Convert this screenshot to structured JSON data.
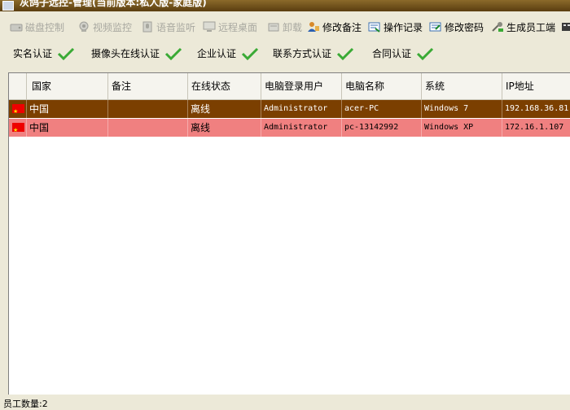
{
  "window": {
    "title": "灰鸽子远控-管理(当前版本:私人版-家庭版)"
  },
  "toolbar": {
    "items": [
      {
        "label": "磁盘控制",
        "icon": "disk-icon",
        "enabled": false
      },
      {
        "label": "视频监控",
        "icon": "webcam-icon",
        "enabled": false
      },
      {
        "label": "语音监听",
        "icon": "microphone-icon",
        "enabled": false
      },
      {
        "label": "远程桌面",
        "icon": "monitor-icon",
        "enabled": false
      },
      {
        "label": "卸载",
        "icon": "uninstall-icon",
        "enabled": false
      },
      {
        "label": "修改备注",
        "icon": "user-edit-icon",
        "enabled": true
      },
      {
        "label": "操作记录",
        "icon": "log-icon",
        "enabled": true
      },
      {
        "label": "修改密码",
        "icon": "password-icon",
        "enabled": true
      },
      {
        "label": "生成员工端",
        "icon": "build-icon",
        "enabled": true
      }
    ]
  },
  "certifications": [
    {
      "label": "实名认证",
      "verified": true
    },
    {
      "label": "摄像头在线认证",
      "verified": true
    },
    {
      "label": "企业认证",
      "verified": true
    },
    {
      "label": "联系方式认证",
      "verified": true
    },
    {
      "label": "合同认证",
      "verified": true
    }
  ],
  "table": {
    "columns": [
      "国家",
      "备注",
      "在线状态",
      "电脑登录用户",
      "电脑名称",
      "系统",
      "IP地址"
    ],
    "rows": [
      {
        "country": "中国",
        "note": "",
        "status": "离线",
        "user": "Administrator",
        "computer": "acer-PC",
        "os": "Windows 7",
        "ip": "192.168.36.81"
      },
      {
        "country": "中国",
        "note": "",
        "status": "离线",
        "user": "Administrator",
        "computer": "pc-13142992",
        "os": "Windows XP",
        "ip": "172.16.1.107"
      }
    ]
  },
  "footer": {
    "employee_count": "员工数量:2"
  },
  "colors": {
    "selected_row": "#7b3f00",
    "highlight_row": "#f08080",
    "check": "#3aaa35"
  }
}
